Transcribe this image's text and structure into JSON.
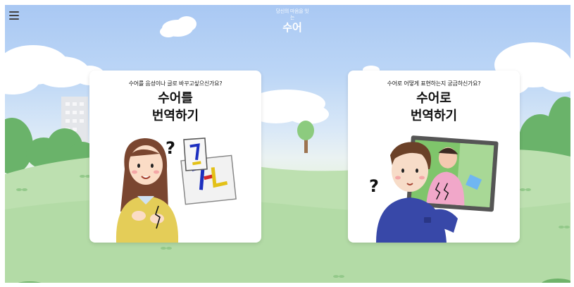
{
  "header": {
    "menu_icon": "hamburger-menu-icon",
    "logo_tagline": "당신의 마음을 잇는",
    "logo_title": "수어"
  },
  "cards": [
    {
      "question": "수어를 음성이나 글로 바꾸고싶으신가요?",
      "title_line1": "수어를",
      "title_line2": "번역하기",
      "illustration": "woman-signing-illustration"
    },
    {
      "question": "수어로 어떻게 표현하는지 궁금하신가요?",
      "title_line1": "수어로",
      "title_line2": "번역하기",
      "illustration": "man-watching-sign-video-illustration"
    }
  ],
  "colors": {
    "sky_top": "#a9c8f3",
    "grass": "#bfe0b1",
    "card_bg": "#ffffff",
    "text": "#111111"
  }
}
